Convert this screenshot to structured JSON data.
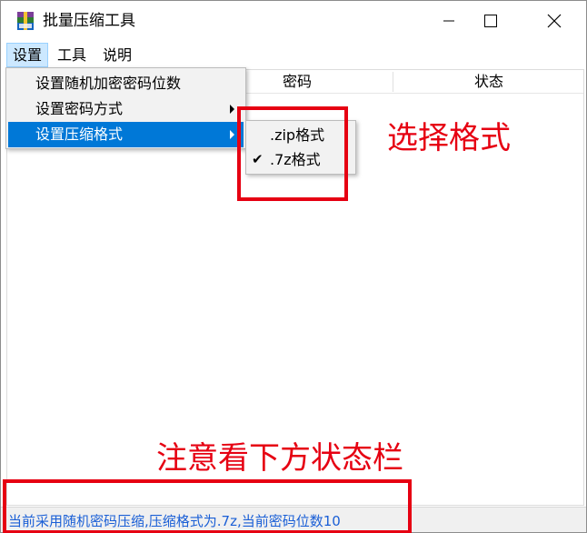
{
  "window": {
    "title": "批量压缩工具",
    "icon": "winrar-archive-icon"
  },
  "controls": {
    "minimize_icon": "minimize-icon",
    "maximize_icon": "maximize-icon",
    "close_icon": "close-icon"
  },
  "menubar": {
    "items": [
      {
        "label": "设置",
        "open": true
      },
      {
        "label": "工具"
      },
      {
        "label": "说明"
      }
    ]
  },
  "settings_menu": {
    "items": [
      {
        "label": "设置随机加密密码位数",
        "has_submenu": false
      },
      {
        "label": "设置密码方式",
        "has_submenu": true
      },
      {
        "label": "设置压缩格式",
        "has_submenu": true,
        "selected": true
      }
    ]
  },
  "format_submenu": {
    "items": [
      {
        "label": ".zip格式",
        "checked": false
      },
      {
        "label": ".7z格式",
        "checked": true
      }
    ],
    "check_glyph": "✔"
  },
  "grid": {
    "columns": [
      "密码",
      "状态"
    ]
  },
  "statusbar": {
    "text": "当前采用随机密码压缩,压缩格式为.7z,当前密码位数10"
  },
  "annotations": {
    "format_caption": "选择格式",
    "status_caption": "注意看下方状态栏",
    "color": "#e60012"
  },
  "colors": {
    "menu_highlight": "#0078d7",
    "menu_hover": "#cce8ff",
    "status_text": "#1a5fd6"
  }
}
